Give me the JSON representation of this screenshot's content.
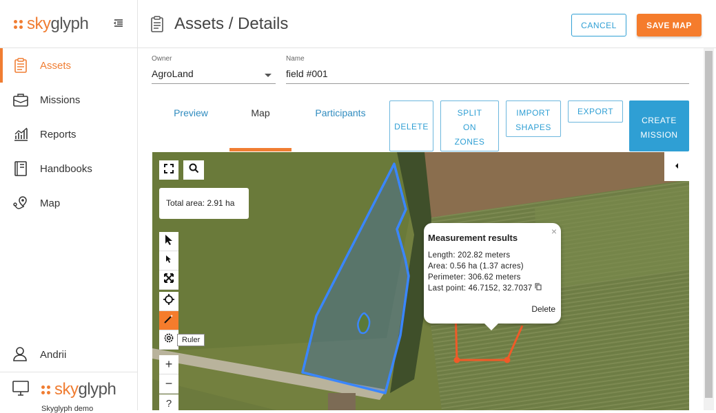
{
  "app": {
    "logo_text_a": "sky",
    "logo_text_b": "glyph"
  },
  "sidebar": {
    "items": [
      {
        "label": "Assets",
        "icon": "clipboard-icon",
        "active": true
      },
      {
        "label": "Missions",
        "icon": "briefcase-icon",
        "active": false
      },
      {
        "label": "Reports",
        "icon": "chart-icon",
        "active": false
      },
      {
        "label": "Handbooks",
        "icon": "book-icon",
        "active": false
      },
      {
        "label": "Map",
        "icon": "map-pin-icon",
        "active": false
      }
    ],
    "user": "Andrii",
    "org_logo_a": "sky",
    "org_logo_b": "glyph",
    "org_name": "Skyglyph demo"
  },
  "header": {
    "title": "Assets / Details",
    "cancel_label": "CANCEL",
    "save_label": "SAVE MAP"
  },
  "form": {
    "owner_label": "Owner",
    "owner_value": "AgroLand",
    "name_label": "Name",
    "name_value": "field #001"
  },
  "tabs": [
    {
      "label": "Preview",
      "active": false
    },
    {
      "label": "Map",
      "active": true
    },
    {
      "label": "Participants",
      "active": false
    }
  ],
  "actions": {
    "delete": "DELETE",
    "split_1": "SPLIT",
    "split_2": "ON",
    "split_3": "ZONES",
    "import_1": "IMPORT",
    "import_2": "SHAPES",
    "export": "EXPORT",
    "create_1": "CREATE",
    "create_2": "MISSION"
  },
  "map": {
    "total_area": "Total area: 2.91 ha",
    "ruler_tooltip": "Ruler",
    "popup": {
      "title": "Measurement results",
      "length": "Length: 202.82 meters",
      "area": "Area: 0.56 ha (1.37 acres)",
      "perimeter": "Perimeter: 306.62 meters",
      "last_point": "Last point: 46.7152, 32.7037",
      "delete": "Delete",
      "close": "×"
    },
    "zoom_in": "+",
    "zoom_out": "−",
    "help": "?"
  },
  "colors": {
    "accent": "#f07d32",
    "primary": "#2f9fd4",
    "field_outline": "#3a86ff",
    "measure_line": "#f05a28"
  }
}
